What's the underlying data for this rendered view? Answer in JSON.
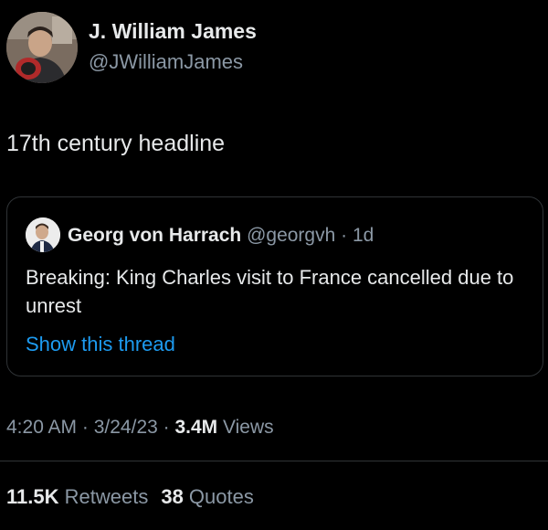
{
  "author": {
    "name": "J. William James",
    "handle": "@JWilliamJames"
  },
  "tweet": {
    "text": "17th century headline"
  },
  "quote": {
    "name": "Georg von Harrach",
    "handle": "@georgvh",
    "separator": " · ",
    "time": "1d",
    "text": "Breaking: King Charles visit to France cancelled due to unrest",
    "show_thread": "Show this thread"
  },
  "meta": {
    "time": "4:20 AM",
    "sep1": " · ",
    "date": "3/24/23",
    "sep2": " · ",
    "views_count": "3.4M",
    "views_label": " Views"
  },
  "stats": {
    "retweets_count": "11.5K",
    "retweets_label": " Retweets",
    "quotes_count": "38",
    "quotes_label": " Quotes"
  },
  "colors": {
    "background": "#000000",
    "text_primary": "#e7e9ea",
    "text_secondary": "#8b98a5",
    "link": "#1d9bf0",
    "border": "#2f3336"
  }
}
